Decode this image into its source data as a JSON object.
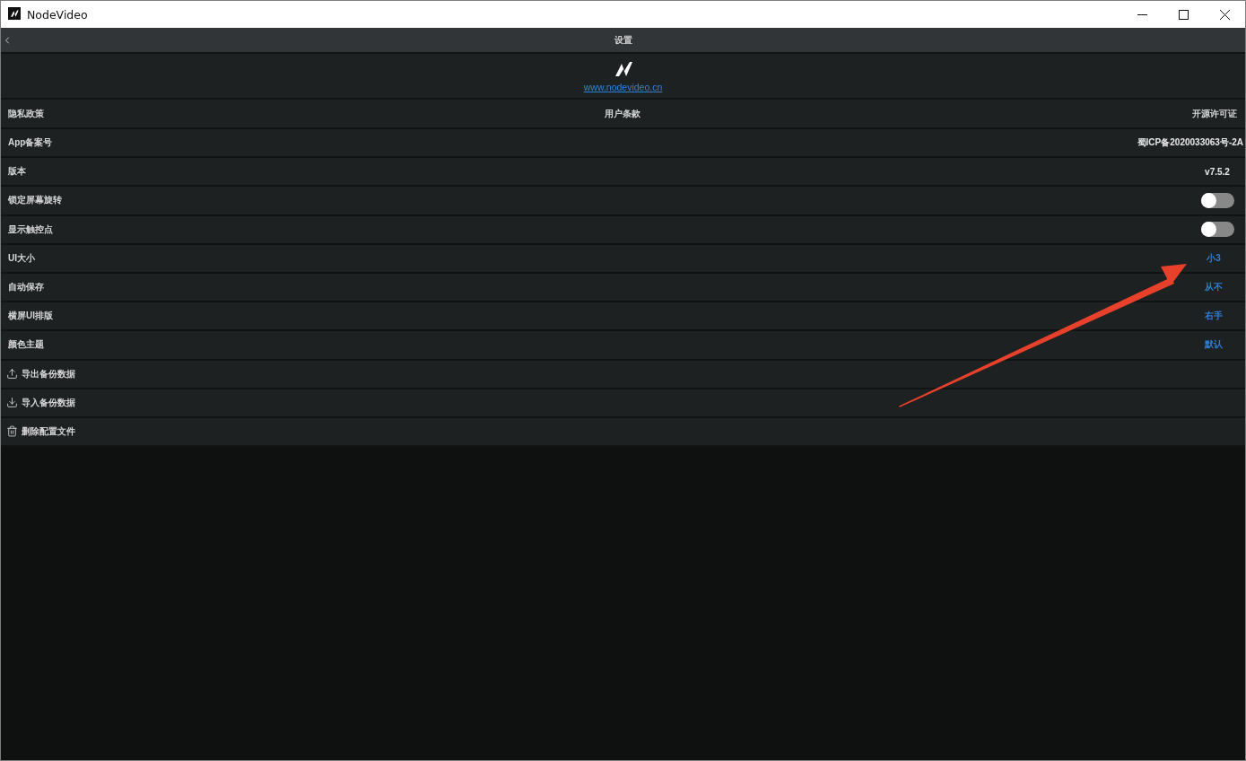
{
  "window": {
    "title": "NodeVideo"
  },
  "header": {
    "title": "设置"
  },
  "about": {
    "link": "www.nodevideo.cn"
  },
  "links": [
    "隐私政策",
    "用户条款",
    "开源许可证"
  ],
  "settings": [
    {
      "kind": "info",
      "label": "App备案号",
      "value": "蜀ICP备2020033063号-2A"
    },
    {
      "kind": "info",
      "label": "版本",
      "value": "v7.5.2"
    },
    {
      "kind": "toggle",
      "label": "锁定屏幕旋转",
      "on": false
    },
    {
      "kind": "toggle",
      "label": "显示触控点",
      "on": false
    },
    {
      "kind": "option",
      "label": "UI大小",
      "value": "小3"
    },
    {
      "kind": "option",
      "label": "自动保存",
      "value": "从不"
    },
    {
      "kind": "option",
      "label": "横屏UI排版",
      "value": "右手"
    },
    {
      "kind": "option",
      "label": "颜色主题",
      "value": "默认"
    },
    {
      "kind": "export",
      "label": "导出备份数据"
    },
    {
      "kind": "import",
      "label": "导入备份数据"
    },
    {
      "kind": "delete",
      "label": "删除配置文件"
    }
  ],
  "annotation": {
    "kind": "arrow"
  }
}
